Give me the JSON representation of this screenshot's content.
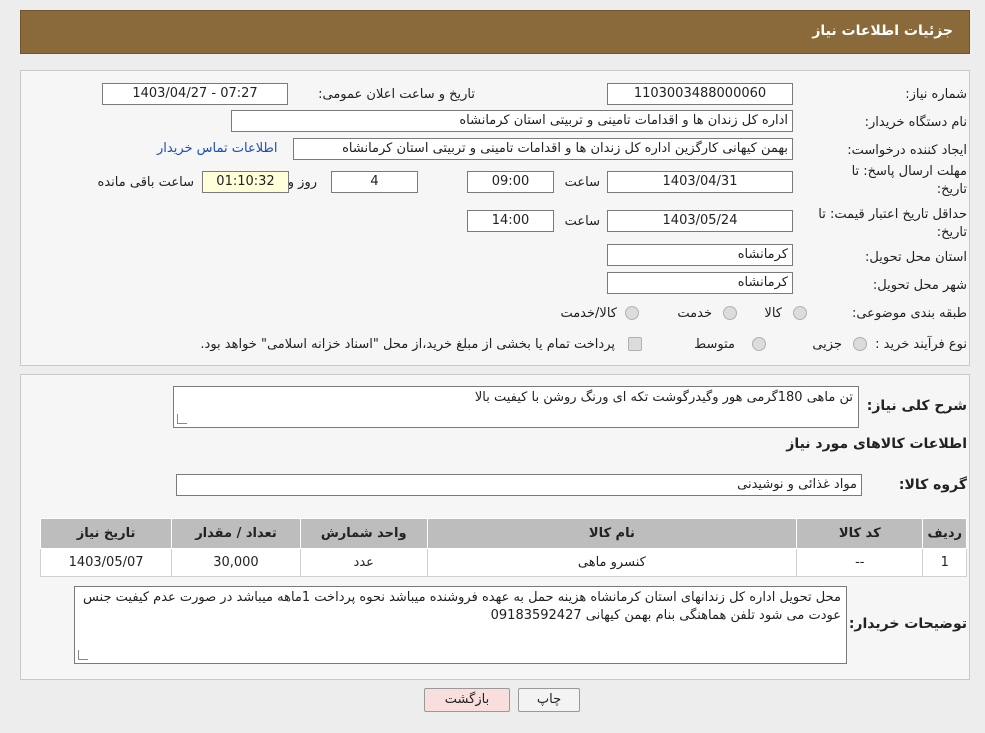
{
  "header": {
    "title": "جزئیات اطلاعات نیاز"
  },
  "form": {
    "need_number_label": "شماره نیاز:",
    "need_number": "1103003488000060",
    "announce_label": "تاریخ و ساعت اعلان عمومی:",
    "announce_value": "1403/04/27 - 07:27",
    "buyer_org_label": "نام دستگاه خریدار:",
    "buyer_org": "اداره کل زندان ها و اقدامات تامینی و تربیتی استان کرمانشاه",
    "creator_label": "ایجاد کننده درخواست:",
    "creator": "بهمن کیهانی کارگزین اداره کل زندان ها و اقدامات تامینی و تربیتی استان کرمانشاه",
    "contact_link": "اطلاعات تماس خریدار",
    "deadline_label_1": "مهلت ارسال پاسخ: تا",
    "deadline_label_2": "تاریخ:",
    "deadline_date": "1403/04/31",
    "time_label": "ساعت",
    "deadline_time": "09:00",
    "days": "4",
    "days_label": "روز و",
    "remaining": "01:10:32",
    "remaining_label": "ساعت باقی مانده",
    "validity_label_1": "حداقل تاریخ اعتبار قیمت: تا",
    "validity_label_2": "تاریخ:",
    "validity_date": "1403/05/24",
    "validity_time": "14:00",
    "province_label": "استان محل تحویل:",
    "province": "کرمانشاه",
    "city_label": "شهر محل تحویل:",
    "city": "کرمانشاه",
    "category_label": "طبقه بندی موضوعی:",
    "category_options": [
      "کالا",
      "خدمت",
      "کالا/خدمت"
    ],
    "process_label": "نوع فرآیند خرید :",
    "process_options": [
      "جزیی",
      "متوسط"
    ],
    "process_note": "پرداخت تمام یا بخشی از مبلغ خرید،از محل \"اسناد خزانه اسلامی\" خواهد بود."
  },
  "details": {
    "summary_label": "شرح کلی نیاز:",
    "summary": "تن ماهی 180گرمی هور وگیدرگوشت تکه ای ورنگ روشن با کیفیت بالا",
    "goods_info_title": "اطلاعات کالاهای مورد نیاز",
    "group_label": "گروه کالا:",
    "group": "مواد غذائی و نوشیدنی",
    "table": {
      "headers": [
        "ردیف",
        "کد کالا",
        "نام کالا",
        "واحد شمارش",
        "تعداد / مقدار",
        "تاریخ نیاز"
      ],
      "rows": [
        [
          "1",
          "--",
          "کنسرو ماهی",
          "عدد",
          "30,000",
          "1403/05/07"
        ]
      ]
    },
    "buyer_notes_label": "توضیحات خریدار:",
    "buyer_notes": "محل تحویل اداره کل زندانهای استان کرمانشاه هزینه حمل به عهده فروشنده میباشد نحوه پرداخت 1ماهه میباشد در صورت عدم کیفیت جنس عودت می شود تلفن هماهنگی بنام بهمن کیهانی  09183592427"
  },
  "buttons": {
    "print": "چاپ",
    "back": "بازگشت"
  }
}
